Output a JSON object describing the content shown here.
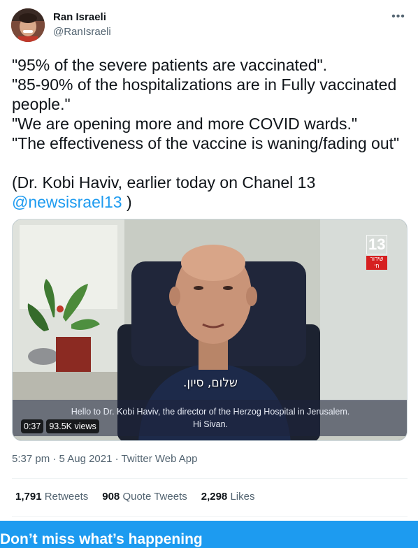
{
  "author": {
    "name": "Ran Israeli",
    "handle": "@RanIsraeli",
    "more_icon": "more-horizontal-icon"
  },
  "tweet": {
    "lines": [
      "\"95% of the severe patients are vaccinated\".",
      "\"85-90% of the hospitalizations are in Fully vaccinated",
      "people.\"",
      "\"We are opening more and more COVID wards.\"",
      "\"The effectiveness of the vaccine is waning/fading out\""
    ],
    "source_line": "(Dr. Kobi Haviv, earlier today on Chanel 13",
    "mention": "@newsisrael13",
    "closing": " )"
  },
  "video": {
    "channel_number": "13",
    "channel_sub": "שידור חי",
    "hebrew_subtitle": "שלום, סיון.",
    "english_subtitle_1": "Hello to Dr. Kobi Haviv, the director of the Herzog Hospital in Jerusalem.",
    "english_subtitle_2": "Hi Sivan.",
    "duration": "0:37",
    "views": "93.5K views"
  },
  "meta": {
    "time": "5:37 pm",
    "sep1": " · ",
    "date": "5 Aug 2021",
    "sep2": " · ",
    "app": "Twitter Web App"
  },
  "stats": {
    "retweets_count": "1,791",
    "retweets_label": "Retweets",
    "quotes_count": "908",
    "quotes_label": "Quote Tweets",
    "likes_count": "2,298",
    "likes_label": "Likes"
  },
  "banner": {
    "text": "Don’t miss what’s happening"
  },
  "colors": {
    "accent": "#1d9bf0",
    "text": "#0f1419",
    "muted": "#536471"
  }
}
